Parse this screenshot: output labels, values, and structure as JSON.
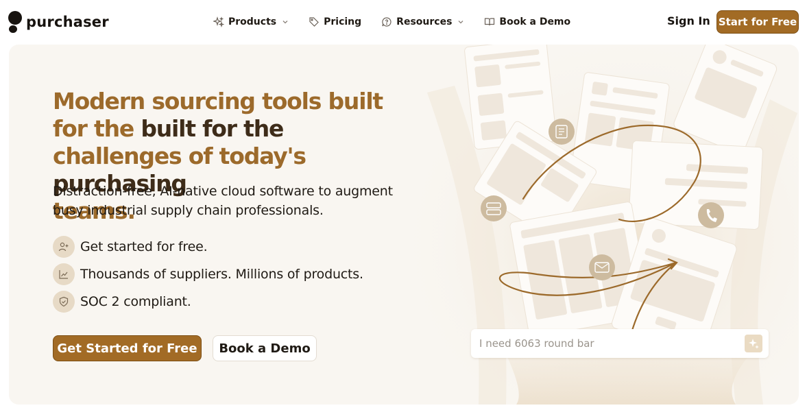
{
  "brand": {
    "name": "purchaser"
  },
  "nav": {
    "items": [
      {
        "label": "Products",
        "icon": "sparkle-icon",
        "dropdown": true
      },
      {
        "label": "Pricing",
        "icon": "tag-icon",
        "dropdown": false
      },
      {
        "label": "Resources",
        "icon": "chat-icon",
        "dropdown": true
      },
      {
        "label": "Book a Demo",
        "icon": "book-icon",
        "dropdown": false
      }
    ],
    "sign_in": "Sign In",
    "start": "Start for Free"
  },
  "hero": {
    "headline_a": "Modern sourcing tools built for the",
    "headline_b": "challenges of today's",
    "headline_c": "purchasing",
    "headline_d": "teams.",
    "subtext": "Distraction-free, AI-native cloud software to augment busy industrial supply chain professionals.",
    "features": [
      {
        "text": "Get started for free.",
        "icon": "user-plus-icon"
      },
      {
        "text": "Thousands of suppliers. Millions of products.",
        "icon": "chart-line-icon"
      },
      {
        "text": "SOC 2 compliant.",
        "icon": "shield-check-icon"
      }
    ],
    "cta_primary": "Get Started for Free",
    "cta_secondary": "Book a Demo",
    "search_placeholder": "I need 6063 round bar"
  },
  "colors": {
    "accent": "#a26b25",
    "headline_gold": "#9c6a2b",
    "headline_dark": "#3e2c19",
    "hero_bg": "#f9f6f1",
    "icon_bg": "#e7dac6"
  }
}
